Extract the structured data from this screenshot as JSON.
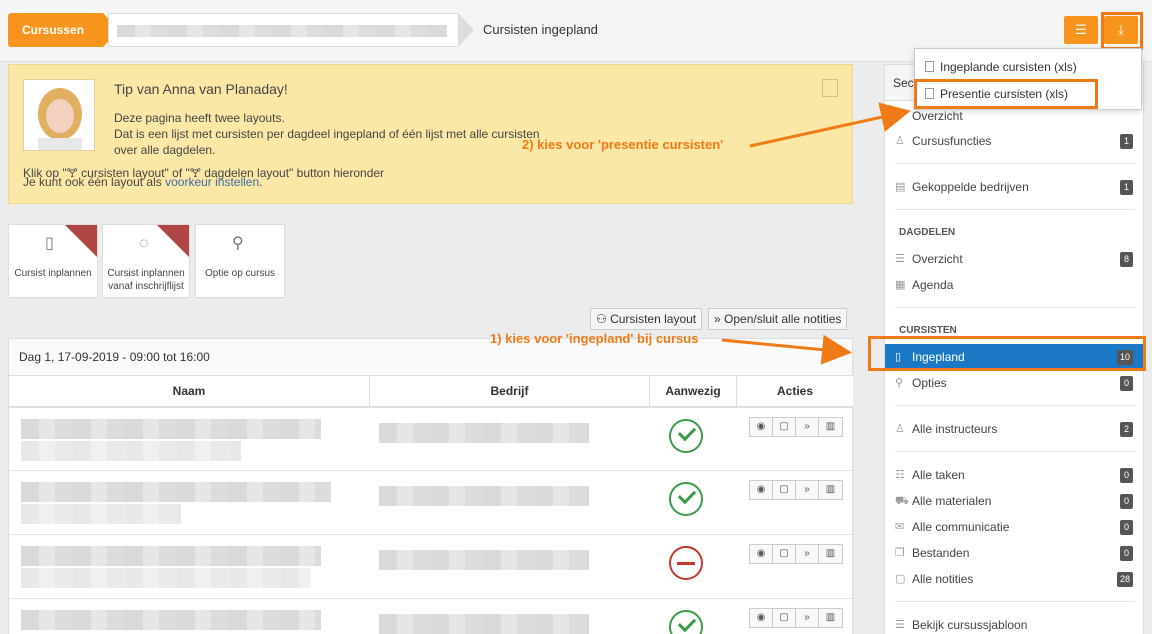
{
  "breadcrumb": {
    "home": "Cursussen",
    "current": "Cursisten ingepland"
  },
  "toolbar": {
    "filter_icon": "list-filter-icon",
    "export_icon": "export-icon"
  },
  "dropdown": {
    "item1": "Ingeplande cursisten (xls)",
    "item2": "Presentie cursisten (xls)"
  },
  "tip": {
    "title": "Tip van Anna van Planaday!",
    "line1": "Deze pagina heeft twee layouts.",
    "line2": "Dat is een lijst met cursisten per dagdeel ingepland of één lijst met alle cursisten",
    "line3": "over alle dagdelen.",
    "line4": "Klik op \"🝖 cursisten layout\" of \"🝖 dagdelen layout\" button hieronder",
    "line5_prefix": "Je kunt ook één layout als",
    "line5_link": "voorkeur instellen",
    "line5_suffix": "."
  },
  "tiles": [
    {
      "label": "Cursist inplannen"
    },
    {
      "label": "Cursist inplannen vanaf inschrijflijst"
    },
    {
      "label": "Optie op cursus"
    }
  ],
  "buttons": {
    "layout": "Cursisten layout",
    "notes": "Open/sluit alle notities"
  },
  "table": {
    "header": "Dag 1, 17-09-2019 - 09:00 tot 16:00",
    "columns": [
      "Naam",
      "Bedrijf",
      "Aanwezig",
      "Acties"
    ],
    "rows": [
      {
        "aanwezig": "yes"
      },
      {
        "aanwezig": "yes"
      },
      {
        "aanwezig": "no"
      },
      {
        "aanwezig": "yes"
      }
    ]
  },
  "sidebar": {
    "head": "Sec",
    "items": [
      {
        "label": "Overzicht"
      },
      {
        "label": "Cursusfuncties",
        "badge": "1"
      },
      {
        "label": "Gekoppelde bedrijven",
        "badge": "1"
      }
    ],
    "section_dagdelen": "DAGDELEN",
    "dagdelen": [
      {
        "label": "Overzicht",
        "badge": "8"
      },
      {
        "label": "Agenda"
      }
    ],
    "section_cursisten": "CURSISTEN",
    "cursisten": [
      {
        "label": "Ingepland",
        "badge": "10"
      },
      {
        "label": "Opties",
        "badge": "0"
      }
    ],
    "instructeurs": {
      "label": "Alle instructeurs",
      "badge": "2"
    },
    "other": [
      {
        "label": "Alle taken",
        "badge": "0"
      },
      {
        "label": "Alle materialen",
        "badge": "0"
      },
      {
        "label": "Alle communicatie",
        "badge": "0"
      },
      {
        "label": "Bestanden",
        "badge": "0"
      },
      {
        "label": "Alle notities",
        "badge": "28"
      }
    ],
    "template": {
      "label": "Bekijk cursussjabloon"
    }
  },
  "annotations": {
    "step1": "1) kies voor 'ingepland' bij cursus",
    "step2": "2) kies voor 'presentie cursisten'"
  },
  "colors": {
    "accent": "#f7941d",
    "highlight": "#f07a16",
    "active": "#1b78c4"
  }
}
